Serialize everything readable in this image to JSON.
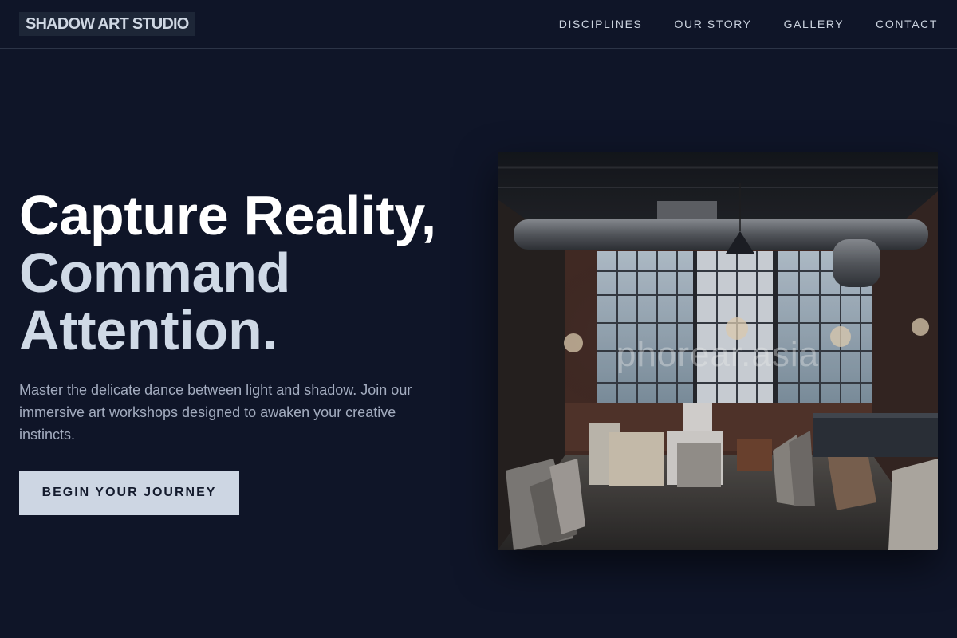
{
  "brand": {
    "name": "SHADOW ART STUDIO"
  },
  "nav": {
    "items": [
      {
        "label": "DISCIPLINES"
      },
      {
        "label": "OUR STORY"
      },
      {
        "label": "GALLERY"
      },
      {
        "label": "CONTACT"
      }
    ]
  },
  "hero": {
    "title_line1": "Capture Reality,",
    "title_line2": "Command",
    "title_line3": "Attention.",
    "lead": "Master the delicate dance between light and shadow. Join our immersive art workshops designed to awaken your creative instincts.",
    "cta_label": "BEGIN YOUR JOURNEY"
  },
  "image": {
    "watermark": "phorear.asia"
  },
  "colors": {
    "background": "#0f1528",
    "accent": "#cdd6e3",
    "text_muted": "#a3acbf"
  }
}
